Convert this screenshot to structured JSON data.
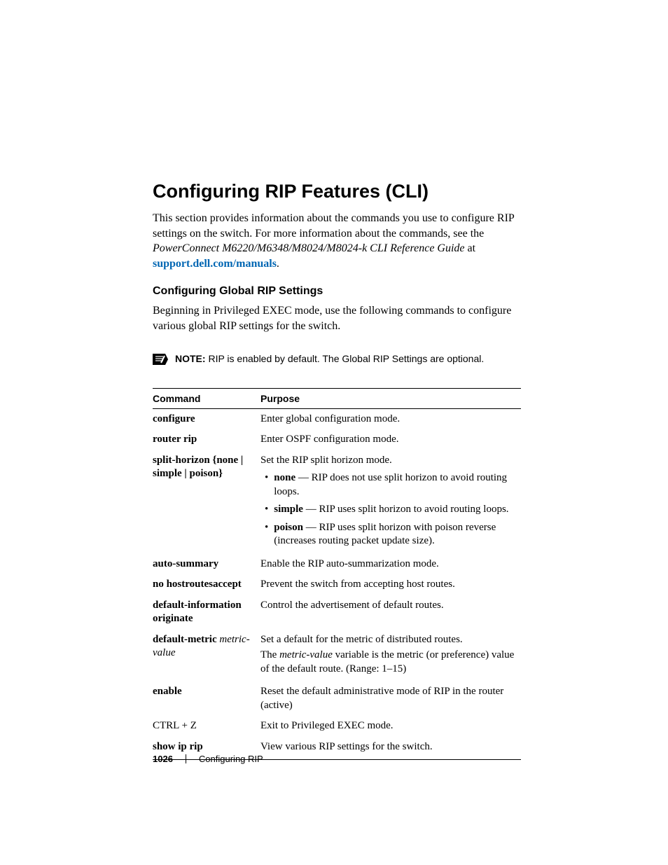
{
  "heading": "Configuring RIP Features (CLI)",
  "intro": {
    "pre": "This section provides information about the commands you use to configure RIP settings on the switch. For more information about the commands, see the ",
    "ital": "PowerConnect M6220/M6348/M8024/M8024-k CLI Reference Guide",
    "post": " at ",
    "link": "support.dell.com/manuals",
    "end": "."
  },
  "subhead": "Configuring Global RIP Settings",
  "subtext": "Beginning in Privileged EXEC mode, use the following commands to configure various global RIP settings for the switch.",
  "note": {
    "label": "NOTE:",
    "text": " RIP is enabled by default. The Global RIP Settings are optional."
  },
  "table": {
    "h1": "Command",
    "h2": "Purpose",
    "rows": [
      {
        "cmd": "configure",
        "purpose": "Enter global configuration mode."
      },
      {
        "cmd": "router rip",
        "purpose": "Enter OSPF configuration mode."
      },
      {
        "cmd": "split-horizon {none | simple | poison}",
        "purpose_lead": "Set the RIP split horizon mode.",
        "bullets": [
          {
            "b": "none",
            "t": " — RIP does not use split horizon to avoid routing loops."
          },
          {
            "b": "simple",
            "t": " — RIP uses split horizon to avoid routing loops."
          },
          {
            "b": "poison",
            "t": " — RIP uses split horizon with poison reverse (increases routing packet update size)."
          }
        ]
      },
      {
        "cmd": "auto-summary",
        "purpose": "Enable the RIP auto-summarization mode."
      },
      {
        "cmd": "no hostroutesaccept",
        "purpose": "Prevent the switch from accepting host routes."
      },
      {
        "cmd": "default-information originate",
        "purpose": "Control the advertisement of default routes."
      },
      {
        "cmd_bold": "default-metric ",
        "cmd_ital": "metric-value",
        "purpose_lead2": "Set a default for the metric of distributed routes.",
        "purpose_extra_pre": "The ",
        "purpose_extra_ital": "metric-value",
        "purpose_extra_post": " variable is the metric (or preference) value of the default route. (Range: 1–15)"
      },
      {
        "cmd": "enable",
        "purpose": "Reset the default administrative mode of RIP in the router (active)"
      },
      {
        "cmd_plain": "CTRL + Z",
        "purpose": "Exit to Privileged EXEC mode."
      },
      {
        "cmd": "show ip rip",
        "purpose": "View various RIP settings for the switch."
      }
    ]
  },
  "footer": {
    "page": "1026",
    "section": "Configuring RIP"
  }
}
